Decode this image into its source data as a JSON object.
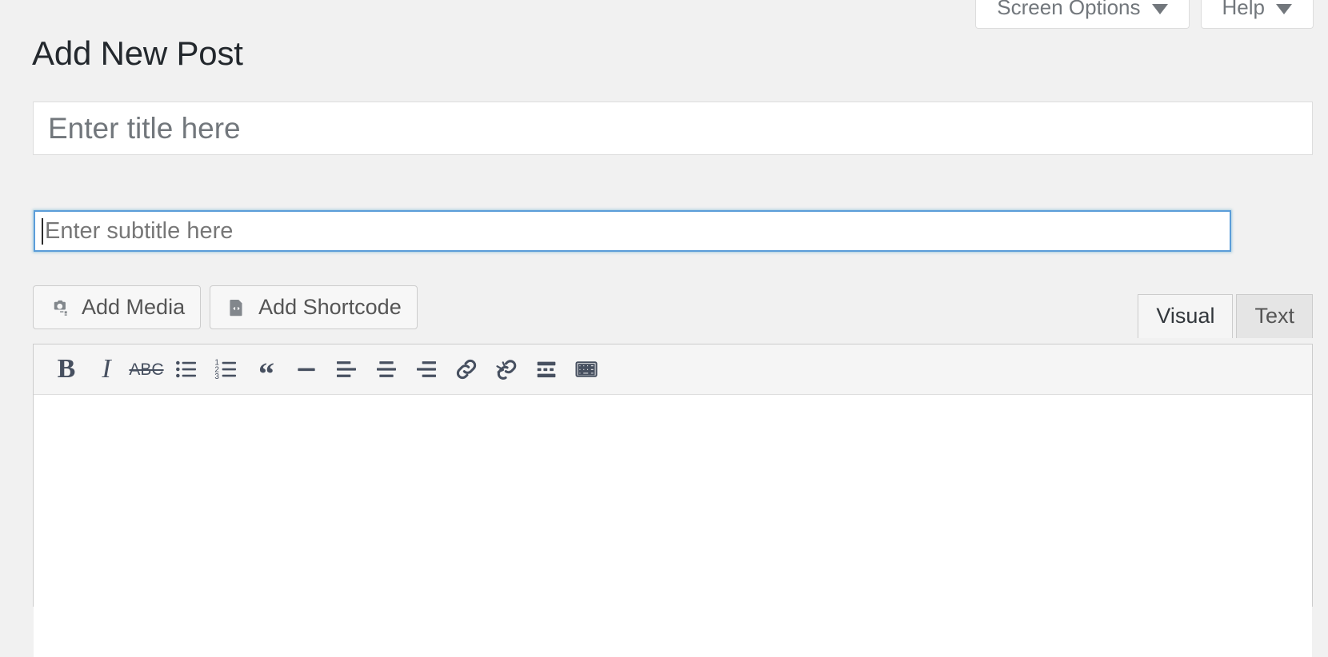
{
  "screen_meta": {
    "buttons": [
      {
        "label": "Screen Options",
        "icon": "chevron-down-icon"
      },
      {
        "label": "Help",
        "icon": "chevron-down-icon"
      }
    ]
  },
  "page": {
    "title": "Add New Post"
  },
  "title_field": {
    "placeholder": "Enter title here",
    "value": ""
  },
  "subtitle_field": {
    "placeholder": "Enter subtitle here",
    "value": "",
    "focused": true,
    "focus_color": "#5b9dd9"
  },
  "media_buttons": [
    {
      "label": "Add Media",
      "icon": "camera-image-icon"
    },
    {
      "label": "Add Shortcode",
      "icon": "code-document-icon"
    }
  ],
  "editor": {
    "tabs": [
      {
        "label": "Visual",
        "active": true
      },
      {
        "label": "Text",
        "active": false
      }
    ],
    "toolbar": [
      {
        "name": "bold-icon",
        "title": "Bold"
      },
      {
        "name": "italic-icon",
        "title": "Italic"
      },
      {
        "name": "strikethrough-icon",
        "title": "Strikethrough"
      },
      {
        "name": "bulleted-list-icon",
        "title": "Bulleted list"
      },
      {
        "name": "numbered-list-icon",
        "title": "Numbered list"
      },
      {
        "name": "blockquote-icon",
        "title": "Blockquote"
      },
      {
        "name": "horizontal-rule-icon",
        "title": "Horizontal line"
      },
      {
        "name": "align-left-icon",
        "title": "Align left"
      },
      {
        "name": "align-center-icon",
        "title": "Align center"
      },
      {
        "name": "align-right-icon",
        "title": "Align right"
      },
      {
        "name": "link-icon",
        "title": "Insert/edit link"
      },
      {
        "name": "unlink-icon",
        "title": "Remove link"
      },
      {
        "name": "read-more-icon",
        "title": "Insert Read More tag"
      },
      {
        "name": "toolbar-toggle-icon",
        "title": "Toolbar Toggle"
      }
    ],
    "content": ""
  },
  "colors": {
    "background": "#f1f1f1",
    "text": "#23282d",
    "muted": "#72777c",
    "icon": "#475060",
    "border": "#cccccc",
    "accent": "#5b9dd9"
  }
}
